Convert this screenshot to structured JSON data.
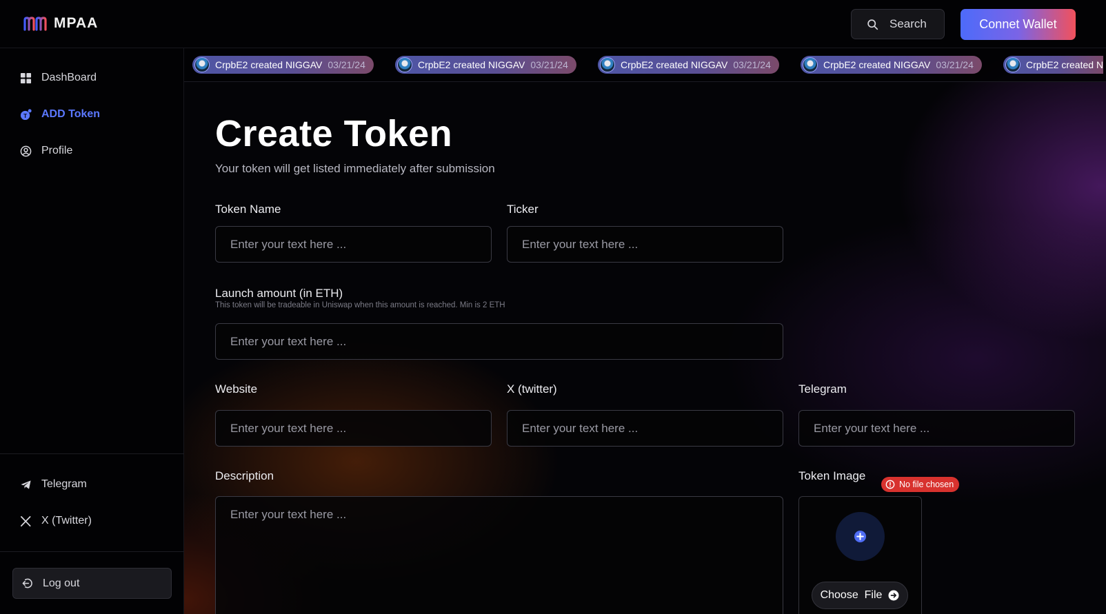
{
  "header": {
    "logo_text": "MPAA",
    "search_label": "Search",
    "wallet_label": "Connet Wallet"
  },
  "sidebar": {
    "items": [
      {
        "label": "DashBoard",
        "icon": "grid-icon",
        "active": false
      },
      {
        "label": "ADD Token",
        "icon": "token-add-icon",
        "active": true
      },
      {
        "label": "Profile",
        "icon": "user-circle-icon",
        "active": false
      }
    ],
    "social": [
      {
        "label": "Telegram",
        "icon": "telegram-icon"
      },
      {
        "label": "X (Twitter)",
        "icon": "x-icon"
      }
    ],
    "logout_label": "Log out"
  },
  "ticker": [
    {
      "text": "CrpbE2 created NIGGAV",
      "date": "03/21/24"
    },
    {
      "text": "CrpbE2 created NIGGAV",
      "date": "03/21/24"
    },
    {
      "text": "CrpbE2 created NIGGAV",
      "date": "03/21/24"
    },
    {
      "text": "CrpbE2 created NIGGAV",
      "date": "03/21/24"
    },
    {
      "text": "CrpbE2 created N",
      "date": ""
    }
  ],
  "form": {
    "title": "Create Token",
    "subtitle": "Your token will get listed immediately after submission",
    "placeholder": "Enter your text here ...",
    "token_name_label": "Token Name",
    "ticker_label": "Ticker",
    "launch_label": "Launch amount (in ETH)",
    "launch_hint": "This token will be tradeable in Uniswap when this amount is reached. Min is 2 ETH",
    "website_label": "Website",
    "twitter_label": "X (twitter)",
    "telegram_label": "Telegram",
    "description_label": "Description",
    "token_image_label": "Token Image",
    "no_file_label": "No file chosen",
    "choose_file_label": "Choose  File"
  },
  "colors": {
    "accent": "#5b78ff",
    "wallet_gradient_start": "#4d6bfa",
    "wallet_gradient_end": "#f1515c",
    "error": "#d8322e"
  }
}
